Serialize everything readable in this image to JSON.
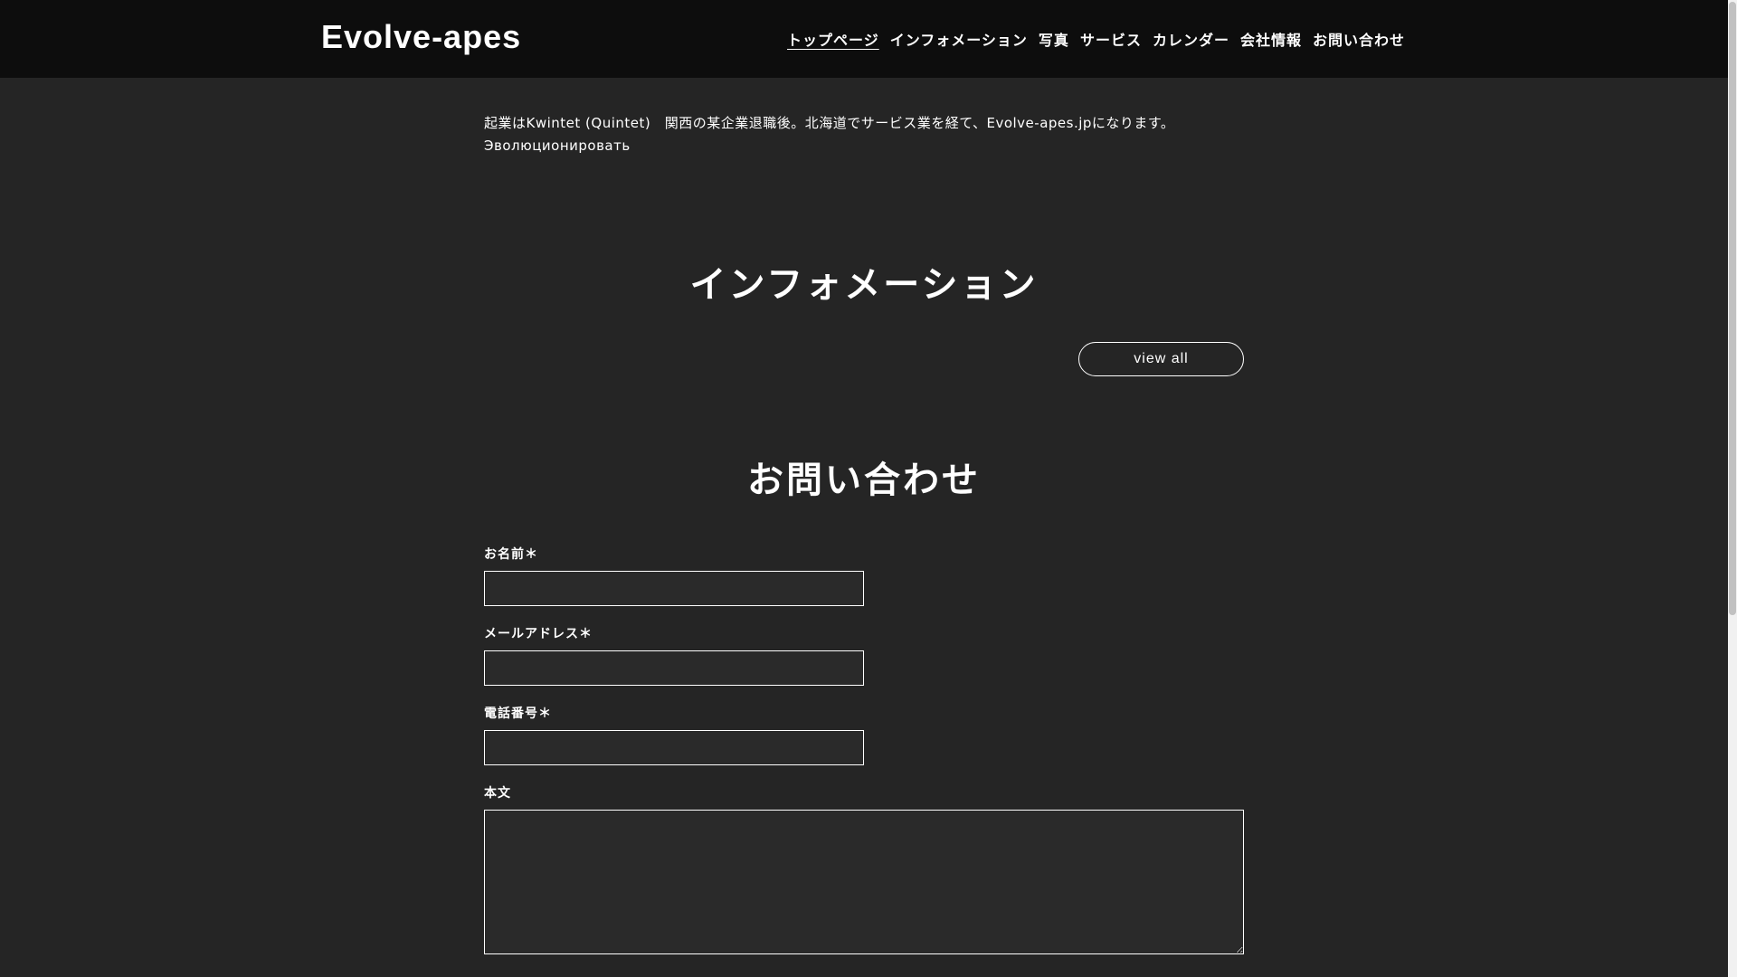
{
  "header": {
    "brand": "Evolve-apes",
    "nav": [
      {
        "label": "トップページ",
        "active": true
      },
      {
        "label": "インフォメーション",
        "active": false
      },
      {
        "label": "写真",
        "active": false
      },
      {
        "label": "サービス",
        "active": false
      },
      {
        "label": "カレンダー",
        "active": false
      },
      {
        "label": "会社情報",
        "active": false
      },
      {
        "label": "お問い合わせ",
        "active": false
      }
    ]
  },
  "intro": {
    "text": "起業はKwintet (Quintet)　関西の某企業退職後。北海道でサービス業を経て、Evolve-apes.jpになります。Эволюционировать"
  },
  "information": {
    "title": "インフォメーション",
    "view_all": "view all"
  },
  "contact": {
    "title": "お問い合わせ",
    "fields": {
      "name": {
        "label": "お名前＊",
        "value": ""
      },
      "email": {
        "label": "メールアドレス＊",
        "value": ""
      },
      "phone": {
        "label": "電話番号＊",
        "value": ""
      },
      "body": {
        "label": "本文",
        "value": ""
      }
    }
  },
  "colors": {
    "background": "#252525",
    "header": "#0d0d0d",
    "text": "#ffffff"
  }
}
